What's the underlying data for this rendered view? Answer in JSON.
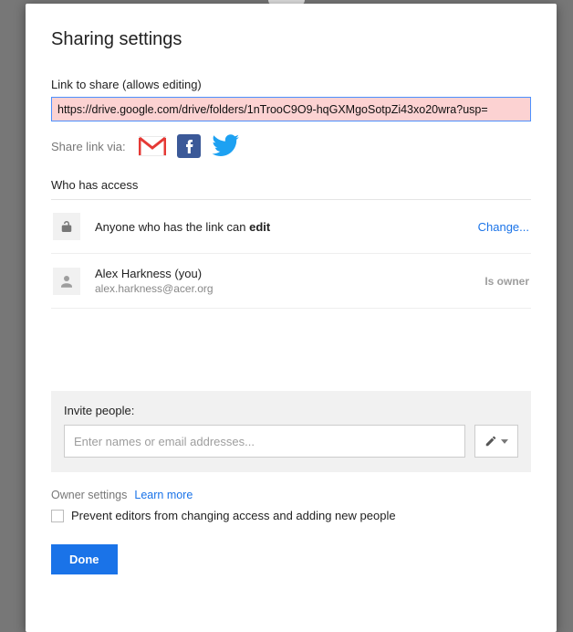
{
  "dialog": {
    "title": "Sharing settings",
    "link_label": "Link to share (allows editing)",
    "share_url": "https://drive.google.com/drive/folders/1nTrooC9O9-hqGXMgoSotpZi43xo20wra?usp=",
    "share_via_label": "Share link via:",
    "access_section_label": "Who has access",
    "access": {
      "public": {
        "text_prefix": "Anyone who has the link can ",
        "text_bold": "edit",
        "change_label": "Change..."
      },
      "owner": {
        "name": "Alex Harkness (you)",
        "email": "alex.harkness@acer.org",
        "badge": "Is owner"
      }
    },
    "invite": {
      "label": "Invite people:",
      "placeholder": "Enter names or email addresses..."
    },
    "owner_settings": {
      "label": "Owner settings",
      "learn_more": "Learn more",
      "checkbox_label": "Prevent editors from changing access and adding new people"
    },
    "done_label": "Done"
  }
}
